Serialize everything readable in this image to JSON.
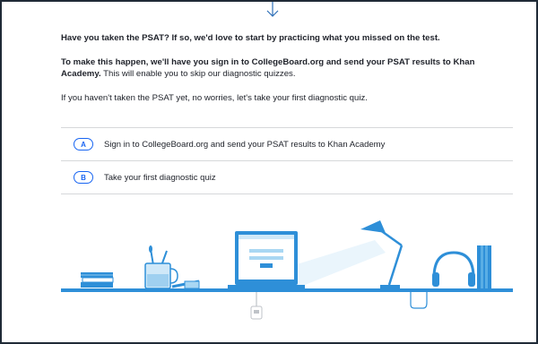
{
  "intro": {
    "question": "Have you taken the PSAT? If so, we'd love to start by practicing what you missed on the test.",
    "plan_bold": "To make this happen, we'll have you sign in to CollegeBoard.org and send your PSAT results to Khan Academy.",
    "plan_rest": " This will enable you to skip our diagnostic quizzes.",
    "not_taken": "If you haven't taken the PSAT yet, no worries, let's take your first diagnostic quiz."
  },
  "options": [
    {
      "letter": "A",
      "label": "Sign in to CollegeBoard.org and send your PSAT results to Khan Academy"
    },
    {
      "letter": "B",
      "label": "Take your first diagnostic quiz"
    }
  ],
  "icons": [
    "down-arrow-icon",
    "books-icon",
    "mug-icon",
    "laptop-icon",
    "desk-lamp-icon",
    "headphones-icon",
    "speaker-icon",
    "power-plug-icon"
  ],
  "colors": {
    "accent": "#1865f2",
    "text": "#21242c",
    "illustration_blue": "#2e8fd8",
    "light_blue": "#a9d7f3"
  }
}
